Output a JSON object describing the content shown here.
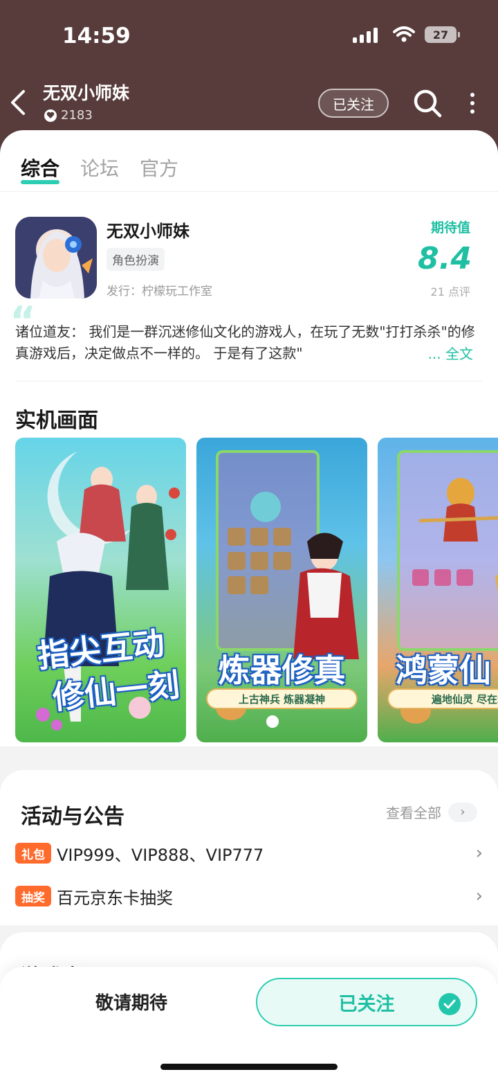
{
  "status_bar": {
    "time": "14:59",
    "battery": "27"
  },
  "header": {
    "title": "无双小师妹",
    "likes": "2183",
    "follow_label": "已关注"
  },
  "tabs": [
    {
      "label": "综合",
      "active": true
    },
    {
      "label": "论坛",
      "active": false
    },
    {
      "label": "官方",
      "active": false
    }
  ],
  "app": {
    "name": "无双小师妹",
    "genre": "角色扮演",
    "publisher": "发行：柠檬玩工作室",
    "expect_label": "期待值",
    "expect_score": "8.4",
    "review_count": "21 点评"
  },
  "description": {
    "text": "诸位道友：   我们是一群沉迷修仙文化的游戏人，在玩了无数\"打打杀杀\"的修真游戏后，决定做点不一样的。  于是有了这款\"",
    "more": "... 全文"
  },
  "screenshots": {
    "title": "实机画面",
    "items": [
      {
        "caption_line1": "指尖互动",
        "caption_line2": "修仙一刻",
        "subtitle": ""
      },
      {
        "caption_line1": "炼器修真",
        "caption_line2": "",
        "subtitle": "上古神兵 炼器凝神"
      },
      {
        "caption_line1": "鸿蒙仙",
        "caption_line2": "",
        "subtitle": "遍地仙灵 尽在囊中"
      }
    ]
  },
  "activity": {
    "title": "活动与公告",
    "view_all": "查看全部",
    "items": [
      {
        "badge": "礼包",
        "text": "VIP999、VIP888、VIP777"
      },
      {
        "badge": "抽奖",
        "text": "百元京东卡抽奖"
      }
    ]
  },
  "next_section": {
    "title": "游戏点评"
  },
  "bottom_bar": {
    "stay_tuned": "敬请期待",
    "followed": "已关注"
  },
  "colors": {
    "header_bg": "#583c3c",
    "accent": "#1ebfa3",
    "badge": "#ff6b2c"
  }
}
